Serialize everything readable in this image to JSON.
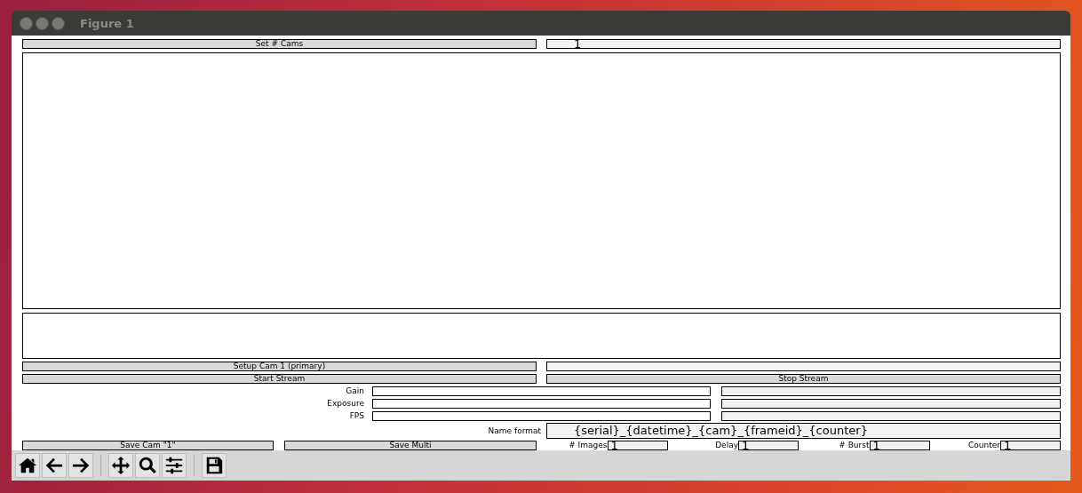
{
  "window": {
    "title": "Figure 1"
  },
  "top_row": {
    "button": "Set # Cams",
    "field_value": "1"
  },
  "setup_row": {
    "button": "Setup Cam 1 (primary)"
  },
  "stream_row": {
    "start": "Start Stream",
    "stop": "Stop Stream"
  },
  "params": [
    {
      "label": "Gain"
    },
    {
      "label": "Exposure"
    },
    {
      "label": "FPS"
    }
  ],
  "name_format": {
    "label": "Name format",
    "value": "{serial}_{datetime}_{cam}_{frameid}_{counter}"
  },
  "save_buttons": [
    "Save Cam \"1\"",
    "Save Multi"
  ],
  "counters": [
    {
      "label": "# Images",
      "value": "1"
    },
    {
      "label": "Delay",
      "value": "1"
    },
    {
      "label": "# Burst",
      "value": "1"
    },
    {
      "label": "Counter",
      "value": "1"
    }
  ],
  "toolbar": [
    {
      "kind": "home"
    },
    {
      "kind": "back"
    },
    {
      "kind": "forward"
    },
    {
      "kind": "separator"
    },
    {
      "kind": "pan"
    },
    {
      "kind": "zoom"
    },
    {
      "kind": "subplots"
    },
    {
      "kind": "separator"
    },
    {
      "kind": "save"
    }
  ]
}
